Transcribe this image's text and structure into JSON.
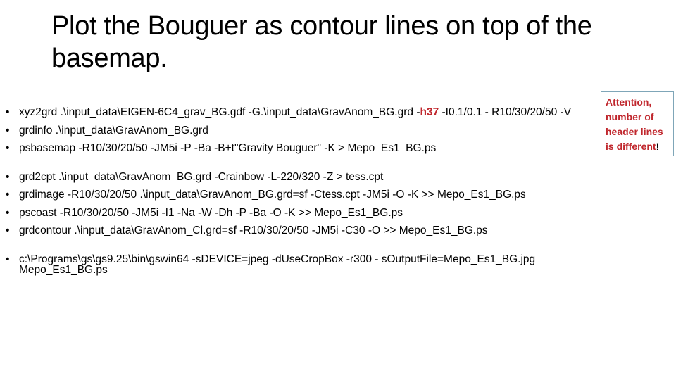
{
  "slide": {
    "title": "Plot the Bouguer as contour lines on top of the basemap.",
    "bullets": [
      {
        "pre": "xyz2grd .\\input_data\\EIGEN-6C4_grav_BG.gdf -G.\\input_data\\GravAnom_BG.grd -",
        "highlight": "h37",
        "post": " -I0.1/0.1 - R10/30/20/50 -V"
      },
      {
        "text": "grdinfo .\\input_data\\GravAnom_BG.grd"
      },
      {
        "text": "psbasemap  -R10/30/20/50 -JM5i  -P -Ba -B+t\"Gravity Bouguer\" -K > Mepo_Es1_BG.ps"
      },
      {
        "text": "grd2cpt .\\input_data\\GravAnom_BG.grd -Crainbow -L-220/320 -Z  > tess.cpt"
      },
      {
        "text": "grdimage -R10/30/20/50 .\\input_data\\GravAnom_BG.grd=sf -Ctess.cpt -JM5i -O -K >> Mepo_Es1_BG.ps"
      },
      {
        "text": "pscoast -R10/30/20/50 -JM5i -I1 -Na -W -Dh -P -Ba -O -K >> Mepo_Es1_BG.ps"
      },
      {
        "text": "grdcontour .\\input_data\\GravAnom_Cl.grd=sf -R10/30/20/50 -JM5i -C30 -O  >> Mepo_Es1_BG.ps"
      },
      {
        "text": "c:\\Programs\\gs\\gs9.25\\bin\\gswin64 -sDEVICE=jpeg -dUseCropBox -r300 - sOutputFile=Mepo_Es1_BG.jpg  Mepo_Es1_BG.ps"
      }
    ],
    "callout": {
      "text": "Attention, number of header lines is different",
      "suffix": "!"
    },
    "colors": {
      "accent_red": "#c0272d",
      "callout_border": "#7fa6b8"
    }
  }
}
